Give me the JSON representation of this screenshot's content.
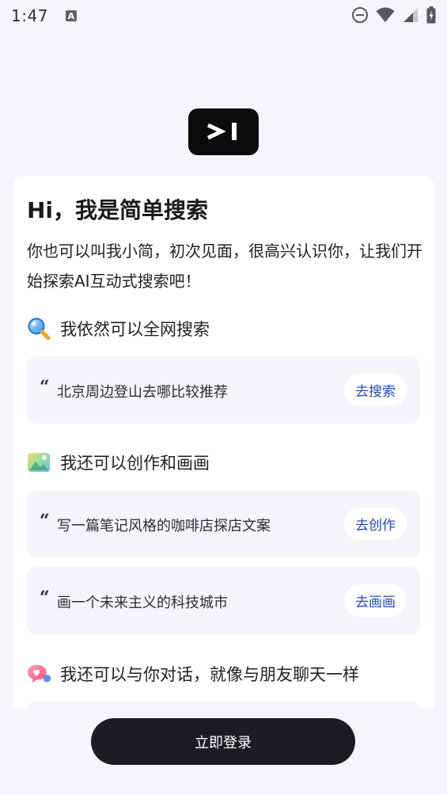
{
  "status_bar": {
    "time": "1:47",
    "notification_letter": "A"
  },
  "card": {
    "greeting": "Hi，我是简单搜索",
    "intro": "你也可以叫我小简，初次见面，很高兴认识你，让我们开始探索AI互动式搜索吧！",
    "sections": [
      {
        "title": "我依然可以全网搜索",
        "icon": "search-magnifier-icon",
        "prompts": [
          {
            "text": "北京周边登山去哪比较推荐",
            "button": "去搜索"
          }
        ]
      },
      {
        "title": "我还可以创作和画画",
        "icon": "picture-icon",
        "prompts": [
          {
            "text": "写一篇笔记风格的咖啡店探店文案",
            "button": "去创作"
          },
          {
            "text": "画一个未来主义的科技城市",
            "button": "去画画"
          }
        ]
      },
      {
        "title": "我还可以与你对话，就像与朋友聊天一样",
        "icon": "chat-heart-icon",
        "prompts": []
      }
    ],
    "quote_mark": "“"
  },
  "login_button": "立即登录"
}
